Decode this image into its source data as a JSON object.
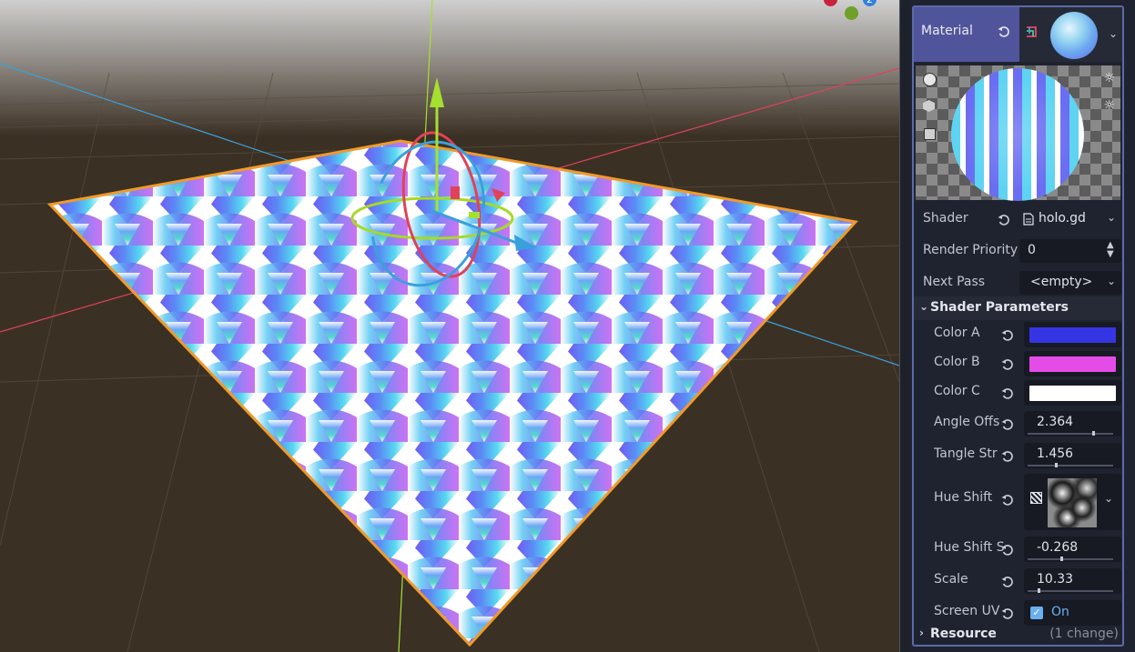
{
  "viewport": {
    "background_color": "#3b3024",
    "sky_color": "#c9c9c9",
    "axis_dots": [
      {
        "label": "",
        "color": "#c8233b"
      },
      {
        "label": "2",
        "color": "#3380e0"
      },
      {
        "label": "",
        "color": "#6ea02a"
      }
    ]
  },
  "inspector": {
    "material": {
      "label": "Material",
      "reset_icon": "reset-icon",
      "resource_icon": "material-resource-icon",
      "dropdown_icon": "chevron-down-icon"
    },
    "preview": {
      "mode_icons": [
        "sphere-preview-icon",
        "cube-preview-icon",
        "plane-preview-icon"
      ],
      "light_icons": [
        "light-one-icon",
        "light-two-icon"
      ]
    },
    "shader": {
      "label": "Shader",
      "value": "holo.gd",
      "file_icon": "script-file-icon"
    },
    "render_priority": {
      "label": "Render Priority",
      "value": "0"
    },
    "next_pass": {
      "label": "Next Pass",
      "value": "<empty>"
    },
    "shader_parameters": {
      "title": "Shader Parameters",
      "color_a": {
        "label": "Color A",
        "color": "#3535e4"
      },
      "color_b": {
        "label": "Color B",
        "color": "#e44ce8"
      },
      "color_c": {
        "label": "Color C",
        "color": "#ffffff"
      },
      "angle_offs": {
        "label": "Angle Offs",
        "value": "2.364",
        "fraction": 0.77
      },
      "tangle_str": {
        "label": "Tangle Str",
        "value": "1.456",
        "fraction": 0.33
      },
      "hue_shift": {
        "label": "Hue Shift",
        "texture_icon": "noise-texture-icon"
      },
      "hue_shift_s": {
        "label": "Hue Shift S",
        "value": "-0.268",
        "fraction": 0.39
      },
      "scale": {
        "label": "Scale",
        "value": "10.33",
        "fraction": 0.13
      },
      "screen_uv": {
        "label": "Screen UV",
        "value": "On",
        "checked": true
      }
    },
    "resource": {
      "title": "Resource",
      "change_note": "(1 change)"
    }
  }
}
